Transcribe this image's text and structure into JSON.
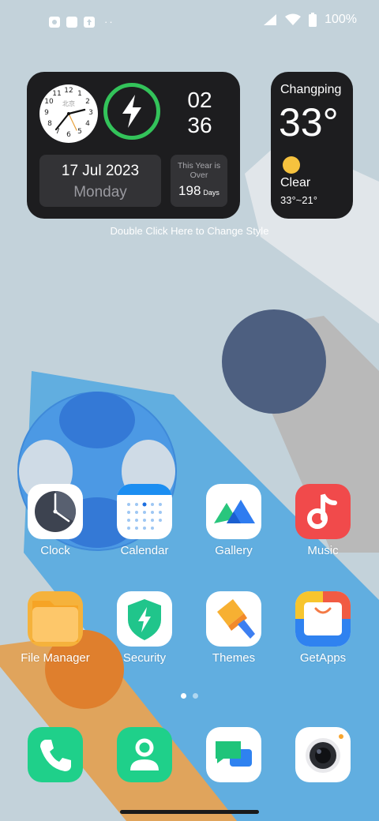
{
  "status": {
    "battery": "100%",
    "icons": [
      "notification-icon",
      "square-icon",
      "upload-icon",
      "more-dots-icon",
      "signal-icon",
      "wifi-icon",
      "battery-icon"
    ],
    "more": "··"
  },
  "clock_widget": {
    "dial_numbers": [
      "12",
      "1",
      "2",
      "3",
      "4",
      "5",
      "6",
      "7",
      "8",
      "9",
      "10",
      "11"
    ],
    "city": "北京",
    "hour": "02",
    "minute": "36",
    "date": "17 Jul 2023",
    "weekday": "Monday",
    "year_label": "This Year is Over",
    "days_over": "198",
    "days_unit": "Days",
    "ring_color": "#33c35a"
  },
  "weather_widget": {
    "city": "Changping",
    "temperature": "33°",
    "condition": "Clear",
    "range": "33°~21°"
  },
  "widget_hint": "Double Click Here to Change Style",
  "apps": [
    {
      "label": "Clock",
      "icon": "clock-icon"
    },
    {
      "label": "Calendar",
      "icon": "calendar-icon"
    },
    {
      "label": "Gallery",
      "icon": "gallery-icon"
    },
    {
      "label": "Music",
      "icon": "music-icon"
    },
    {
      "label": "File Manager",
      "icon": "folder-icon"
    },
    {
      "label": "Security",
      "icon": "shield-icon"
    },
    {
      "label": "Themes",
      "icon": "paintbrush-icon"
    },
    {
      "label": "GetApps",
      "icon": "shopping-bag-icon"
    }
  ],
  "dock": [
    {
      "icon": "phone-icon"
    },
    {
      "icon": "contacts-icon"
    },
    {
      "icon": "messages-icon"
    },
    {
      "icon": "camera-icon"
    }
  ],
  "pages": {
    "count": 2,
    "current": 1
  },
  "colors": {
    "wallpaper": "#c3d2da",
    "widget_bg": "#1d1d1f",
    "sun": "#f6c23e",
    "music": "#f14a4b",
    "dock_green": "#1fd08a"
  }
}
